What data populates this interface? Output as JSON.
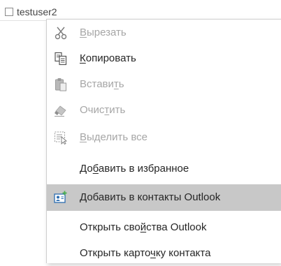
{
  "row": {
    "user_name": "testuser2"
  },
  "context_menu": {
    "items": [
      {
        "pre": "",
        "acc": "В",
        "post": "ырезать",
        "icon": "scissors-icon",
        "enabled": false
      },
      {
        "pre": "",
        "acc": "К",
        "post": "опировать",
        "icon": "copy-icon",
        "enabled": true
      },
      {
        "pre": "Встави",
        "acc": "т",
        "post": "ь",
        "icon": "paste-icon",
        "enabled": false
      },
      {
        "pre": "Очис",
        "acc": "т",
        "post": "ить",
        "icon": "eraser-icon",
        "enabled": false
      },
      {
        "pre": "",
        "acc": "В",
        "post": "ыделить все",
        "icon": "select-all-icon",
        "enabled": false
      },
      {
        "pre": "До",
        "acc": "б",
        "post": "авить в избранное",
        "icon": "",
        "enabled": true
      },
      {
        "pre": "",
        "acc": "Д",
        "post": "обавить в контакты Outlook",
        "icon": "add-contact-icon",
        "enabled": true,
        "highlighted": true
      },
      {
        "pre": "Открыть сво",
        "acc": "й",
        "post": "ства Outlook",
        "icon": "",
        "enabled": true
      },
      {
        "pre": "Открыть карто",
        "acc": "ч",
        "post": "ку контакта",
        "icon": "",
        "enabled": true
      }
    ]
  },
  "colors": {
    "disabled_text": "#a6a6a6",
    "enabled_text": "#262626",
    "highlight_bg": "#c8c8c8",
    "contact_card_blue": "#2b6cb0",
    "plus_green": "#4caf50"
  }
}
